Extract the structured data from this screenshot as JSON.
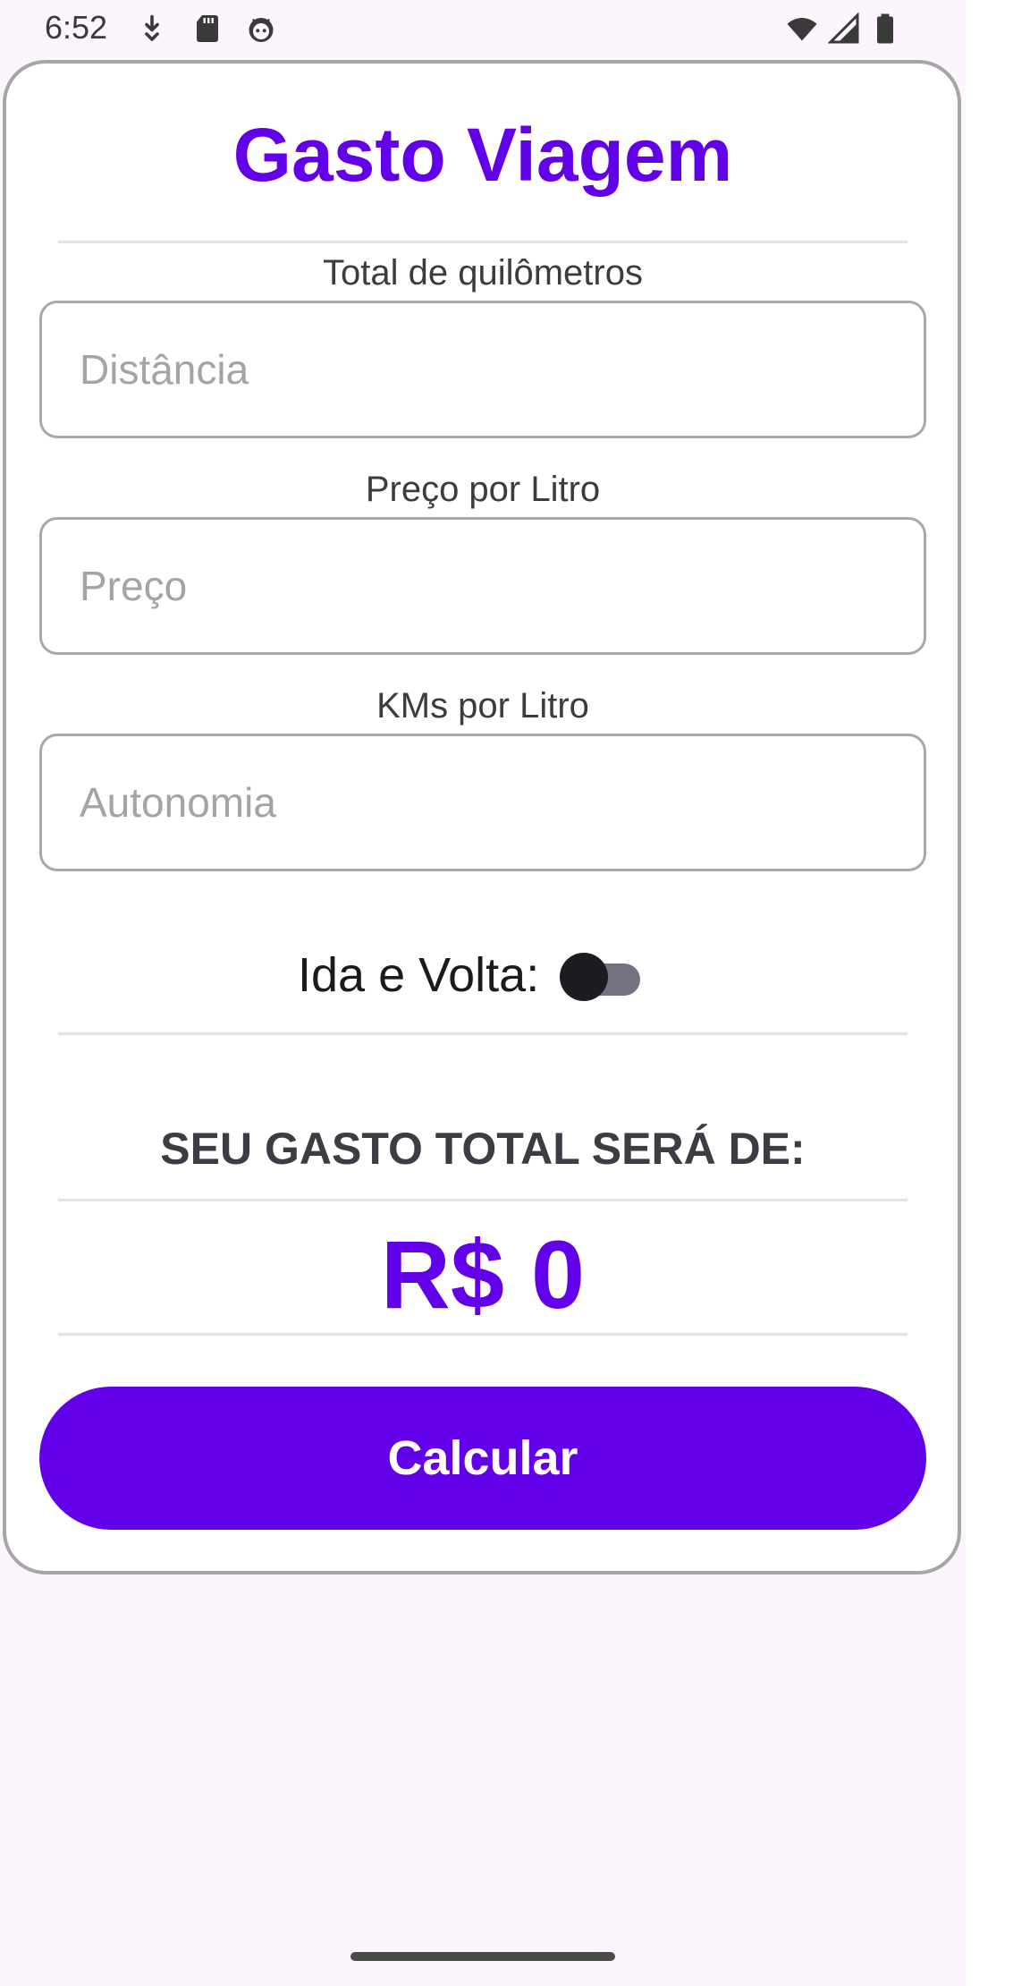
{
  "status_bar": {
    "time": "6:52",
    "left_icons": [
      "download-arrow-icon",
      "sd-card-icon",
      "android-face-icon"
    ],
    "right_icons": [
      "wifi-icon",
      "cell-signal-icon",
      "battery-icon"
    ]
  },
  "app": {
    "title": "Gasto Viagem",
    "accent_color": "#6200ea"
  },
  "form": {
    "distance": {
      "label": "Total de quilômetros",
      "value": "",
      "placeholder": "Distância"
    },
    "price": {
      "label": "Preço por Litro",
      "value": "",
      "placeholder": "Preço"
    },
    "autonomy": {
      "label": "KMs por Litro",
      "value": "",
      "placeholder": "Autonomia"
    },
    "round_trip": {
      "label": "Ida e Volta:",
      "checked": false
    }
  },
  "result": {
    "heading": "SEU GASTO TOTAL SERÁ DE:",
    "value": "R$ 0"
  },
  "actions": {
    "calculate_label": "Calcular"
  }
}
